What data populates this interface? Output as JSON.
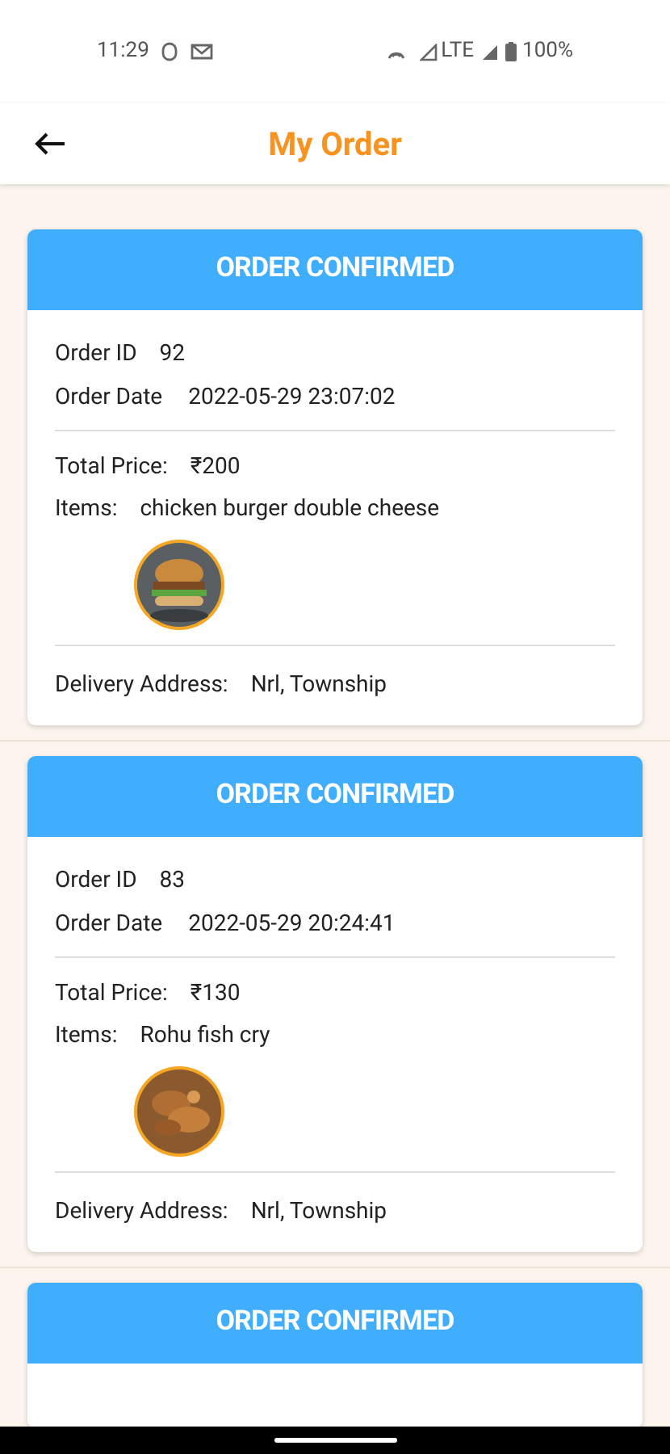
{
  "status_bar": {
    "time": "11:29",
    "network": "LTE",
    "battery": "100%"
  },
  "app_bar": {
    "title": "My Order"
  },
  "orders": [
    {
      "status": "ORDER CONFIRMED",
      "order_id_label": "Order ID",
      "order_id": "92",
      "date_label": "Order Date",
      "date": "2022-05-29 23:07:02",
      "price_label": "Total Price:",
      "price": "₹200",
      "items_label": "Items:",
      "items": "chicken burger double cheese",
      "address_label": "Delivery Address:",
      "address": "Nrl, Township"
    },
    {
      "status": "ORDER CONFIRMED",
      "order_id_label": "Order ID",
      "order_id": "83",
      "date_label": "Order Date",
      "date": "2022-05-29 20:24:41",
      "price_label": "Total Price:",
      "price": "₹130",
      "items_label": "Items:",
      "items": "Rohu fish cry",
      "address_label": "Delivery Address:",
      "address": "Nrl, Township"
    },
    {
      "status": "ORDER CONFIRMED"
    }
  ]
}
